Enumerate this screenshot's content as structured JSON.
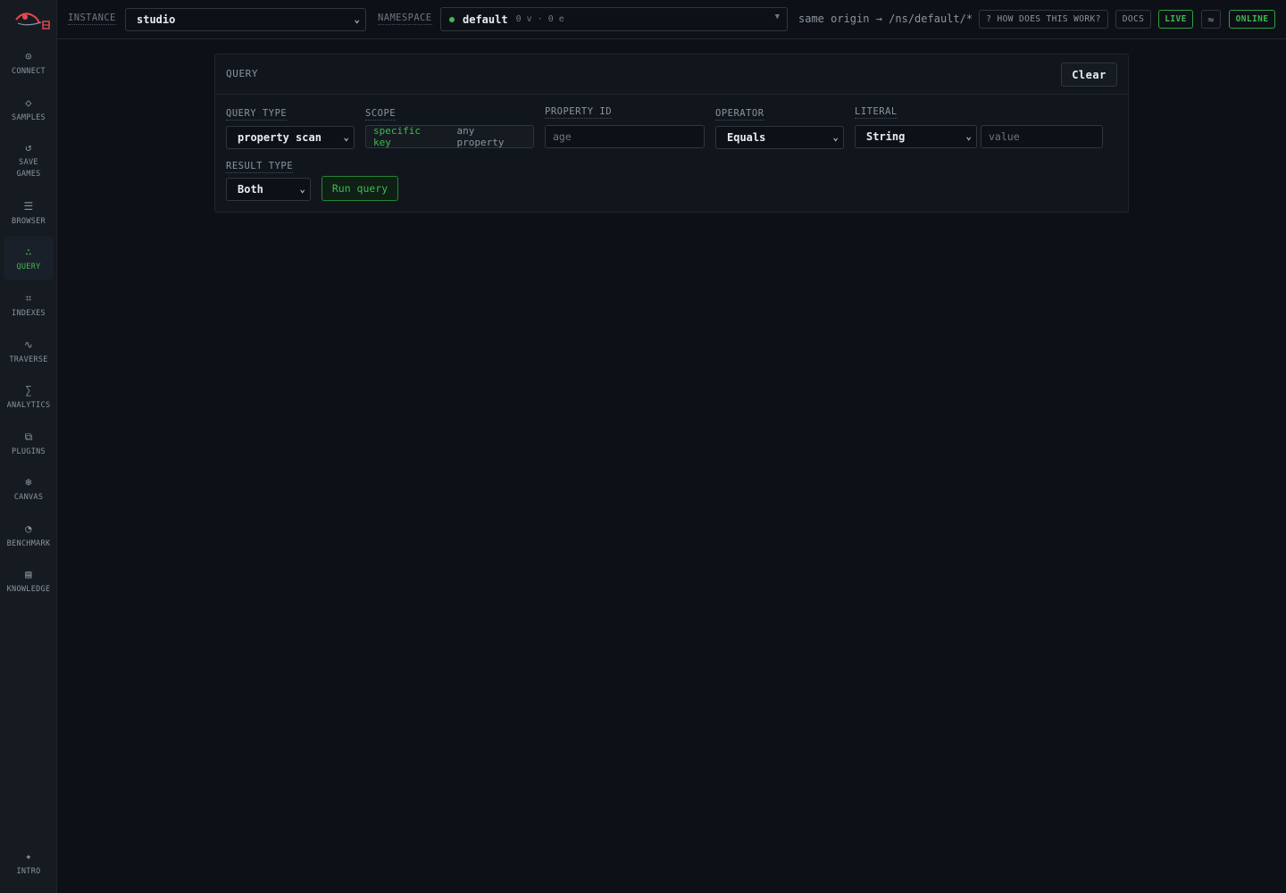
{
  "sidebar": {
    "items": [
      {
        "icon": "target-icon",
        "glyph": "⊙",
        "label": "CONNECT"
      },
      {
        "icon": "diamond-icon",
        "glyph": "◇",
        "label": "SAMPLES"
      },
      {
        "icon": "refresh-icon",
        "glyph": "↺",
        "label": "SAVE GAMES"
      },
      {
        "icon": "list-icon",
        "glyph": "☰",
        "label": "BROWSER"
      },
      {
        "icon": "dots-icon",
        "glyph": "∴",
        "label": "QUERY",
        "active": true
      },
      {
        "icon": "grid-icon",
        "glyph": "⌗",
        "label": "INDEXES"
      },
      {
        "icon": "wave-icon",
        "glyph": "∿",
        "label": "TRAVERSE"
      },
      {
        "icon": "sigma-icon",
        "glyph": "∑",
        "label": "ANALYTICS"
      },
      {
        "icon": "plugin-icon",
        "glyph": "⧉",
        "label": "PLUGINS"
      },
      {
        "icon": "snowflake-icon",
        "glyph": "❄",
        "label": "CANVAS"
      },
      {
        "icon": "gauge-icon",
        "glyph": "◔",
        "label": "BENCHMARK"
      },
      {
        "icon": "book-icon",
        "glyph": "▤",
        "label": "KNOWLEDGE"
      }
    ],
    "intro": {
      "icon": "sparkle-icon",
      "glyph": "✦",
      "label": "INTRO"
    }
  },
  "topbar": {
    "instance_label": "INSTANCE",
    "instance_value": "studio",
    "namespace_label": "NAMESPACE",
    "namespace_value": "default",
    "namespace_meta": "0 v · 0 e",
    "route": "same origin → /ns/default/*",
    "help": "? HOW DOES THIS WORK?",
    "docs": "DOCS",
    "live": "LIVE",
    "theme_glyph": "≈",
    "online": "ONLINE"
  },
  "query": {
    "title": "QUERY",
    "clear": "Clear",
    "query_type_label": "QUERY TYPE",
    "query_type_value": "property scan",
    "scope_label": "SCOPE",
    "scope_options": [
      "specific key",
      "any property"
    ],
    "property_id_label": "PROPERTY ID",
    "property_id_placeholder": "age",
    "operator_label": "OPERATOR",
    "operator_value": "Equals",
    "literal_label": "LITERAL",
    "literal_type": "String",
    "literal_placeholder": "value",
    "result_type_label": "RESULT TYPE",
    "result_type_value": "Both",
    "run": "Run query"
  },
  "colors": {
    "accent": "#3fb950",
    "background": "#0d1117",
    "logo_red": "#e5484d"
  }
}
